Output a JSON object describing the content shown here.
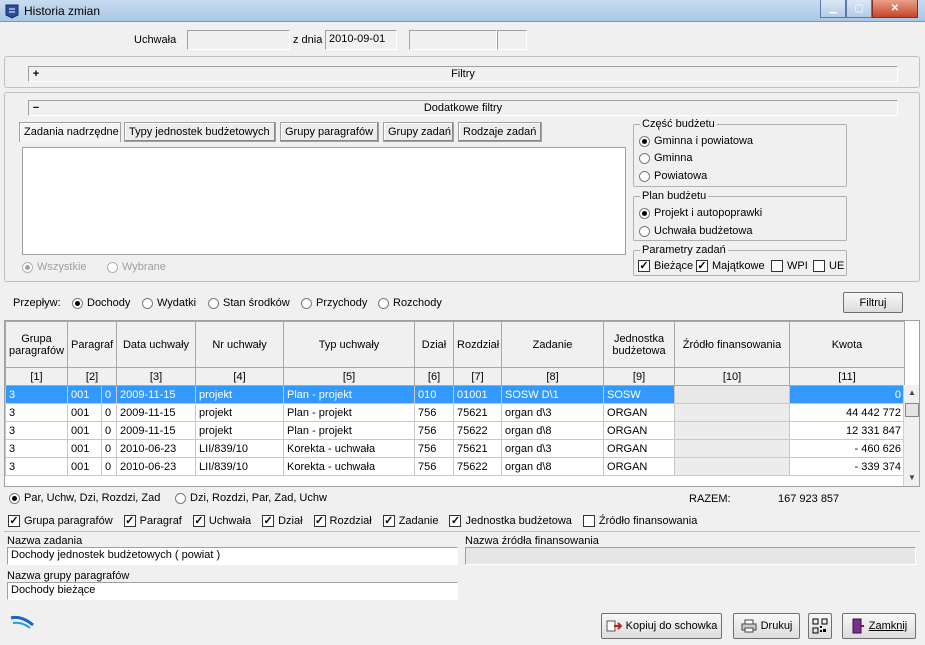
{
  "window": {
    "title": "Historia zmian"
  },
  "header": {
    "uchwala_label": "Uchwała",
    "uchwala_value": "",
    "zdnia_label": "z dnia",
    "zdnia_value": "2010-09-01",
    "extra1": "",
    "extra2": ""
  },
  "filters_panel": {
    "toggle": "+",
    "label": "Filtry"
  },
  "extra_filters": {
    "toggle": "−",
    "label": "Dodatkowe filtry",
    "tabs": [
      "Zadania nadrzędne",
      "Typy jednostek budżetowych",
      "Grupy paragrafów",
      "Grupy zadań",
      "Rodzaje zadań"
    ],
    "active_tab": "Zadania nadrzędne",
    "scope_all": "Wszystkie",
    "scope_selected": "Wybrane",
    "czesc_budzetu": {
      "title": "Część budżetu",
      "options": [
        "Gminna i powiatowa",
        "Gminna",
        "Powiatowa"
      ],
      "selected": "Gminna i powiatowa"
    },
    "plan_budzetu": {
      "title": "Plan budżetu",
      "options": [
        "Projekt i autopoprawki",
        "Uchwała budżetowa"
      ],
      "selected": "Projekt i autopoprawki"
    },
    "parametry_zadan": {
      "title": "Parametry zadań",
      "items": [
        {
          "label": "Bieżące",
          "checked": true
        },
        {
          "label": "Majątkowe",
          "checked": true
        },
        {
          "label": "WPI",
          "checked": false
        },
        {
          "label": "UE",
          "checked": false
        }
      ]
    }
  },
  "przeplywy": {
    "label": "Przepływ:",
    "options": [
      "Dochody",
      "Wydatki",
      "Stan środków",
      "Przychody",
      "Rozchody"
    ],
    "selected": "Dochody",
    "filter_button": "Filtruj"
  },
  "grid": {
    "headers": [
      "Grupa paragrafów",
      "Paragraf",
      "Data uchwały",
      "Nr uchwały",
      "Typ uchwały",
      "Dział",
      "Rozdział",
      "Zadanie",
      "Jednostka budżetowa",
      "Źródło finansowania",
      "Kwota"
    ],
    "indexes": [
      "[1]",
      "[2]",
      "[3]",
      "[4]",
      "[5]",
      "[6]",
      "[7]",
      "[8]",
      "[9]",
      "[10]",
      "[11]"
    ],
    "rows": [
      {
        "grupa": "3",
        "paragraf": "001",
        "p2": "0",
        "data": "2009-11-15",
        "nr": "projekt",
        "typ": "Plan - projekt",
        "dzial": "010",
        "rozdzial": "01001",
        "zadanie": "SOSW D\\1",
        "jednostka": "SOSW",
        "zrodlo": "",
        "kwota": "0"
      },
      {
        "grupa": "3",
        "paragraf": "001",
        "p2": "0",
        "data": "2009-11-15",
        "nr": "projekt",
        "typ": "Plan - projekt",
        "dzial": "756",
        "rozdzial": "75621",
        "zadanie": "organ d\\3",
        "jednostka": "ORGAN",
        "zrodlo": "",
        "kwota": "44 442 772"
      },
      {
        "grupa": "3",
        "paragraf": "001",
        "p2": "0",
        "data": "2009-11-15",
        "nr": "projekt",
        "typ": "Plan - projekt",
        "dzial": "756",
        "rozdzial": "75622",
        "zadanie": "organ d\\8",
        "jednostka": "ORGAN",
        "zrodlo": "",
        "kwota": "12 331 847"
      },
      {
        "grupa": "3",
        "paragraf": "001",
        "p2": "0",
        "data": "2010-06-23",
        "nr": "LII/839/10",
        "typ": "Korekta - uchwała",
        "dzial": "756",
        "rozdzial": "75621",
        "zadanie": "organ d\\3",
        "jednostka": "ORGAN",
        "zrodlo": "",
        "kwota": "-   460 626"
      },
      {
        "grupa": "3",
        "paragraf": "001",
        "p2": "0",
        "data": "2010-06-23",
        "nr": "LII/839/10",
        "typ": "Korekta - uchwała",
        "dzial": "756",
        "rozdzial": "75622",
        "zadanie": "organ d\\8",
        "jednostka": "ORGAN",
        "zrodlo": "",
        "kwota": "-   339 374"
      }
    ]
  },
  "sort": {
    "options": [
      "Par, Uchw, Dzi, Rozdzi, Zad",
      "Dzi, Rozdzi, Par, Zad, Uchw"
    ],
    "selected": "Par, Uchw, Dzi, Rozdzi, Zad",
    "razem_label": "RAZEM:",
    "razem_value": "167 923 857"
  },
  "columns_visible": [
    {
      "label": "Grupa paragrafów",
      "checked": true
    },
    {
      "label": "Paragraf",
      "checked": true
    },
    {
      "label": "Uchwała",
      "checked": true
    },
    {
      "label": "Dział",
      "checked": true
    },
    {
      "label": "Rozdział",
      "checked": true
    },
    {
      "label": "Zadanie",
      "checked": true
    },
    {
      "label": "Jednostka budżetowa",
      "checked": true
    },
    {
      "label": "Źródło finansowania",
      "checked": false
    }
  ],
  "details": {
    "nazwa_zadania_label": "Nazwa zadania",
    "nazwa_zadania_value": "Dochody jednostek budżetowych ( powiat )",
    "nazwa_zrodla_label": "Nazwa źródła finansowania",
    "nazwa_zrodla_value": "",
    "nazwa_grupy_label": "Nazwa grupy paragrafów",
    "nazwa_grupy_value": "Dochody bieżące"
  },
  "footer": {
    "kopiuj": "Kopiuj do schowka",
    "drukuj": "Drukuj",
    "zamknij": "Zamknij"
  },
  "colors": {
    "selection": "#3399ff",
    "window_bg": "#f0f0f0"
  }
}
